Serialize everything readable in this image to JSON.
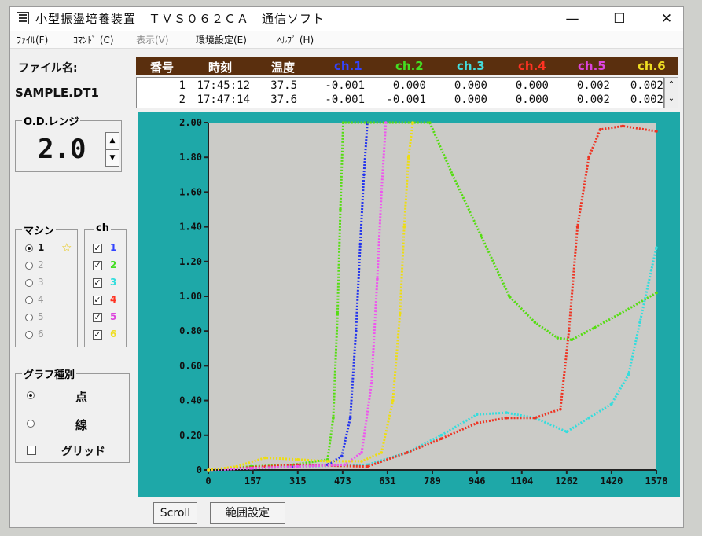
{
  "window": {
    "title": "小型振盪培養装置　ＴＶＳ０６２ＣＡ　通信ソフト",
    "minimize_glyph": "—",
    "maximize_glyph": "☐",
    "close_glyph": "✕"
  },
  "menu": [
    {
      "label": "ﾌｧｲﾙ(F)",
      "enabled": true
    },
    {
      "label": "ｺﾏﾝﾄﾞ (C)",
      "enabled": true
    },
    {
      "label": "表示(V)",
      "enabled": false
    },
    {
      "label": "環境設定(E)",
      "enabled": true
    },
    {
      "label": "ﾍﾙﾌﾟ (H)",
      "enabled": true
    }
  ],
  "file": {
    "label": "ファイル名:",
    "name": "SAMPLE.DT1"
  },
  "table": {
    "columns": [
      {
        "label": "番号",
        "color": "#ffffff"
      },
      {
        "label": "時刻",
        "color": "#ffffff"
      },
      {
        "label": "温度",
        "color": "#ffffff"
      },
      {
        "label": "ch.1",
        "color": "#3344ff"
      },
      {
        "label": "ch.2",
        "color": "#44dd22"
      },
      {
        "label": "ch.3",
        "color": "#44dddd"
      },
      {
        "label": "ch.4",
        "color": "#ff3322"
      },
      {
        "label": "ch.5",
        "color": "#dd44dd"
      },
      {
        "label": "ch.6",
        "color": "#eedd22"
      }
    ],
    "rows": [
      [
        "1",
        "17:45:12",
        "37.5",
        "-0.001",
        "0.000",
        "0.000",
        "0.000",
        "0.002",
        "0.002"
      ],
      [
        "2",
        "17:47:14",
        "37.6",
        "-0.001",
        "-0.001",
        "0.000",
        "0.000",
        "0.002",
        "0.002"
      ]
    ]
  },
  "od_range": {
    "label": "O.D.レンジ",
    "value": "2.0",
    "up_glyph": "▲",
    "down_glyph": "▼"
  },
  "machine": {
    "label": "マシン",
    "options": [
      "1",
      "2",
      "3",
      "4",
      "5",
      "6"
    ],
    "selected": "1",
    "star": "☆",
    "star_color": "#e8c400"
  },
  "channels": {
    "label": "ch",
    "items": [
      {
        "num": "1",
        "checked": true,
        "color": "#3344ff"
      },
      {
        "num": "2",
        "checked": true,
        "color": "#44dd22"
      },
      {
        "num": "3",
        "checked": true,
        "color": "#33dddd"
      },
      {
        "num": "4",
        "checked": true,
        "color": "#ff3322"
      },
      {
        "num": "5",
        "checked": true,
        "color": "#dd44dd"
      },
      {
        "num": "6",
        "checked": true,
        "color": "#eedd22"
      }
    ]
  },
  "graph_type": {
    "label": "グラフ種別",
    "dot_label": "点",
    "line_label": "線",
    "grid_label": "グリッド",
    "selected": "dot",
    "grid_checked": false
  },
  "buttons": {
    "scroll": "Scroll",
    "range": "範囲設定"
  },
  "colors": {
    "plot_frame": "#1ea8a8",
    "plot_bg": "#cbcbc7",
    "header_bar": "#5a2f0e"
  },
  "chart_data": {
    "type": "scatter",
    "grid": false,
    "xlim": [
      0,
      1578
    ],
    "ylim": [
      0,
      2.0
    ],
    "x_ticks": [
      "0",
      "157",
      "315",
      "473",
      "631",
      "789",
      "946",
      "1104",
      "1262",
      "1420",
      "1578"
    ],
    "y_ticks": [
      "0",
      "0.20",
      "0.40",
      "0.60",
      "0.80",
      "1.00",
      "1.20",
      "1.40",
      "1.60",
      "1.80",
      "2.00"
    ],
    "series": [
      {
        "name": "ch.1",
        "color": "#2233ee",
        "points": [
          [
            0,
            0
          ],
          [
            150,
            0.01
          ],
          [
            300,
            0.02
          ],
          [
            420,
            0.03
          ],
          [
            470,
            0.08
          ],
          [
            500,
            0.3
          ],
          [
            520,
            0.8
          ],
          [
            535,
            1.3
          ],
          [
            548,
            1.7
          ],
          [
            560,
            2.0
          ]
        ]
      },
      {
        "name": "ch.2",
        "color": "#55dd11",
        "points": [
          [
            0,
            0
          ],
          [
            150,
            0.02
          ],
          [
            300,
            0.03
          ],
          [
            420,
            0.06
          ],
          [
            440,
            0.3
          ],
          [
            455,
            0.9
          ],
          [
            465,
            1.5
          ],
          [
            475,
            2.0
          ],
          [
            780,
            2.0
          ],
          [
            860,
            1.7
          ],
          [
            960,
            1.35
          ],
          [
            1060,
            1.0
          ],
          [
            1150,
            0.85
          ],
          [
            1230,
            0.76
          ],
          [
            1280,
            0.75
          ],
          [
            1360,
            0.82
          ],
          [
            1450,
            0.9
          ],
          [
            1578,
            1.02
          ]
        ]
      },
      {
        "name": "ch.3",
        "color": "#33dddd",
        "points": [
          [
            0,
            0
          ],
          [
            315,
            0.02
          ],
          [
            560,
            0.03
          ],
          [
            700,
            0.1
          ],
          [
            820,
            0.2
          ],
          [
            946,
            0.32
          ],
          [
            1050,
            0.33
          ],
          [
            1150,
            0.3
          ],
          [
            1262,
            0.22
          ],
          [
            1340,
            0.3
          ],
          [
            1420,
            0.38
          ],
          [
            1480,
            0.55
          ],
          [
            1520,
            0.85
          ],
          [
            1560,
            1.15
          ],
          [
            1578,
            1.28
          ]
        ]
      },
      {
        "name": "ch.4",
        "color": "#ee3322",
        "points": [
          [
            0,
            0
          ],
          [
            200,
            0.02
          ],
          [
            315,
            0.03
          ],
          [
            560,
            0.02
          ],
          [
            700,
            0.1
          ],
          [
            820,
            0.18
          ],
          [
            946,
            0.27
          ],
          [
            1050,
            0.3
          ],
          [
            1150,
            0.3
          ],
          [
            1240,
            0.35
          ],
          [
            1270,
            0.8
          ],
          [
            1300,
            1.4
          ],
          [
            1340,
            1.8
          ],
          [
            1380,
            1.96
          ],
          [
            1460,
            1.98
          ],
          [
            1578,
            1.95
          ]
        ]
      },
      {
        "name": "ch.5",
        "color": "#ee55ee",
        "points": [
          [
            0,
            0
          ],
          [
            150,
            0.01
          ],
          [
            315,
            0.02
          ],
          [
            480,
            0.03
          ],
          [
            540,
            0.1
          ],
          [
            575,
            0.5
          ],
          [
            595,
            1.1
          ],
          [
            610,
            1.6
          ],
          [
            625,
            2.0
          ]
        ]
      },
      {
        "name": "ch.6",
        "color": "#eedd11",
        "points": [
          [
            0,
            0
          ],
          [
            100,
            0.02
          ],
          [
            200,
            0.07
          ],
          [
            315,
            0.06
          ],
          [
            420,
            0.05
          ],
          [
            540,
            0.05
          ],
          [
            610,
            0.1
          ],
          [
            650,
            0.4
          ],
          [
            675,
            0.9
          ],
          [
            690,
            1.4
          ],
          [
            705,
            1.8
          ],
          [
            720,
            2.0
          ]
        ]
      }
    ]
  }
}
